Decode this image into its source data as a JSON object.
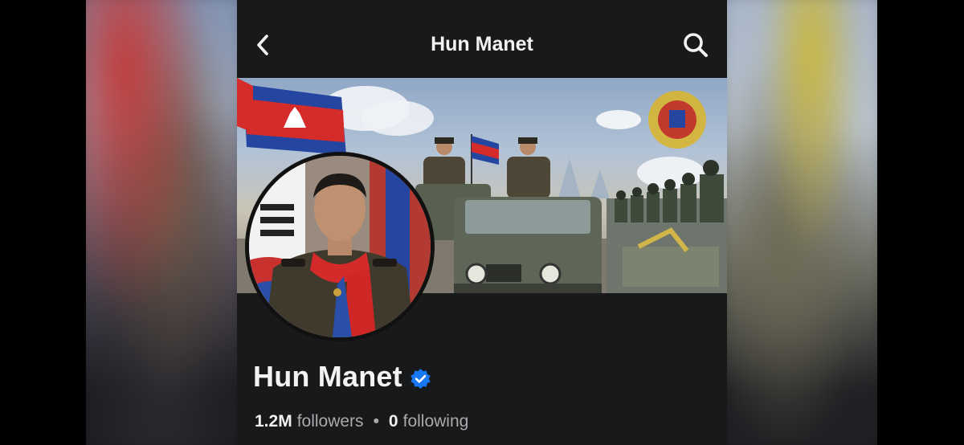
{
  "header": {
    "title": "Hun Manet",
    "back_icon": "chevron-left-icon",
    "search_icon": "search-icon"
  },
  "profile": {
    "name": "Hun Manet",
    "verified_icon": "verified-badge-icon",
    "verified_color": "#1877f2",
    "followers_count": "1.2M",
    "followers_label": "followers",
    "separator": "•",
    "following_count": "0",
    "following_label": "following"
  },
  "colors": {
    "background": "#18191b",
    "text_primary": "#f2f2f2",
    "text_secondary": "#a9aaac"
  }
}
